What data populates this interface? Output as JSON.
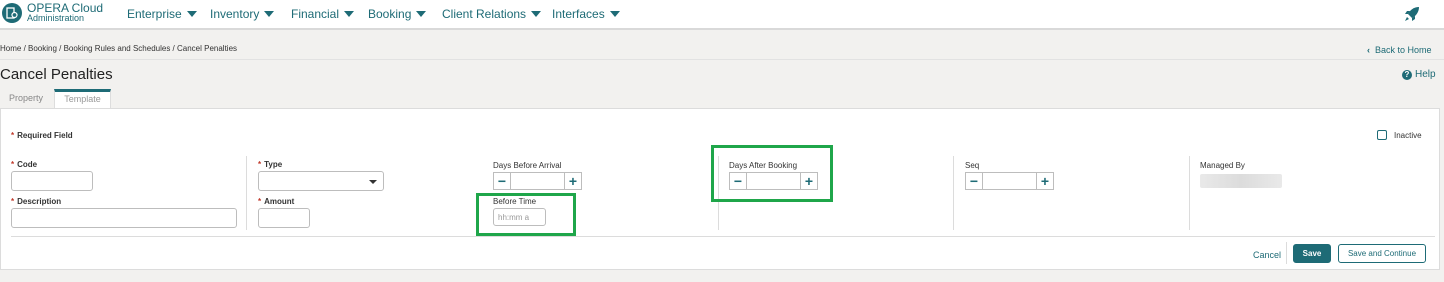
{
  "app": {
    "brand_line1": "OPERA Cloud",
    "brand_line2": "Administration"
  },
  "nav": [
    "Enterprise",
    "Inventory",
    "Financial",
    "Booking",
    "Client Relations",
    "Interfaces"
  ],
  "breadcrumb": "Home / Booking / Booking Rules and Schedules / Cancel Penalties",
  "back_home": "Back to Home",
  "page_title": "Cancel Penalties",
  "help": "Help",
  "tabs": {
    "property": "Property",
    "template": "Template"
  },
  "form": {
    "required_note": "Required Field",
    "inactive_label": "Inactive",
    "code_label": "Code",
    "description_label": "Description",
    "type_label": "Type",
    "amount_label": "Amount",
    "days_before_arrival_label": "Days Before Arrival",
    "before_time_label": "Before Time",
    "before_time_placeholder": "hh:mm a",
    "days_after_booking_label": "Days After Booking",
    "seq_label": "Seq",
    "managed_by_label": "Managed By"
  },
  "actions": {
    "cancel": "Cancel",
    "save": "Save",
    "save_continue": "Save and Continue"
  },
  "colors": {
    "accent": "#1e6b76",
    "highlight": "#1fa64a",
    "required": "#c0392b"
  }
}
